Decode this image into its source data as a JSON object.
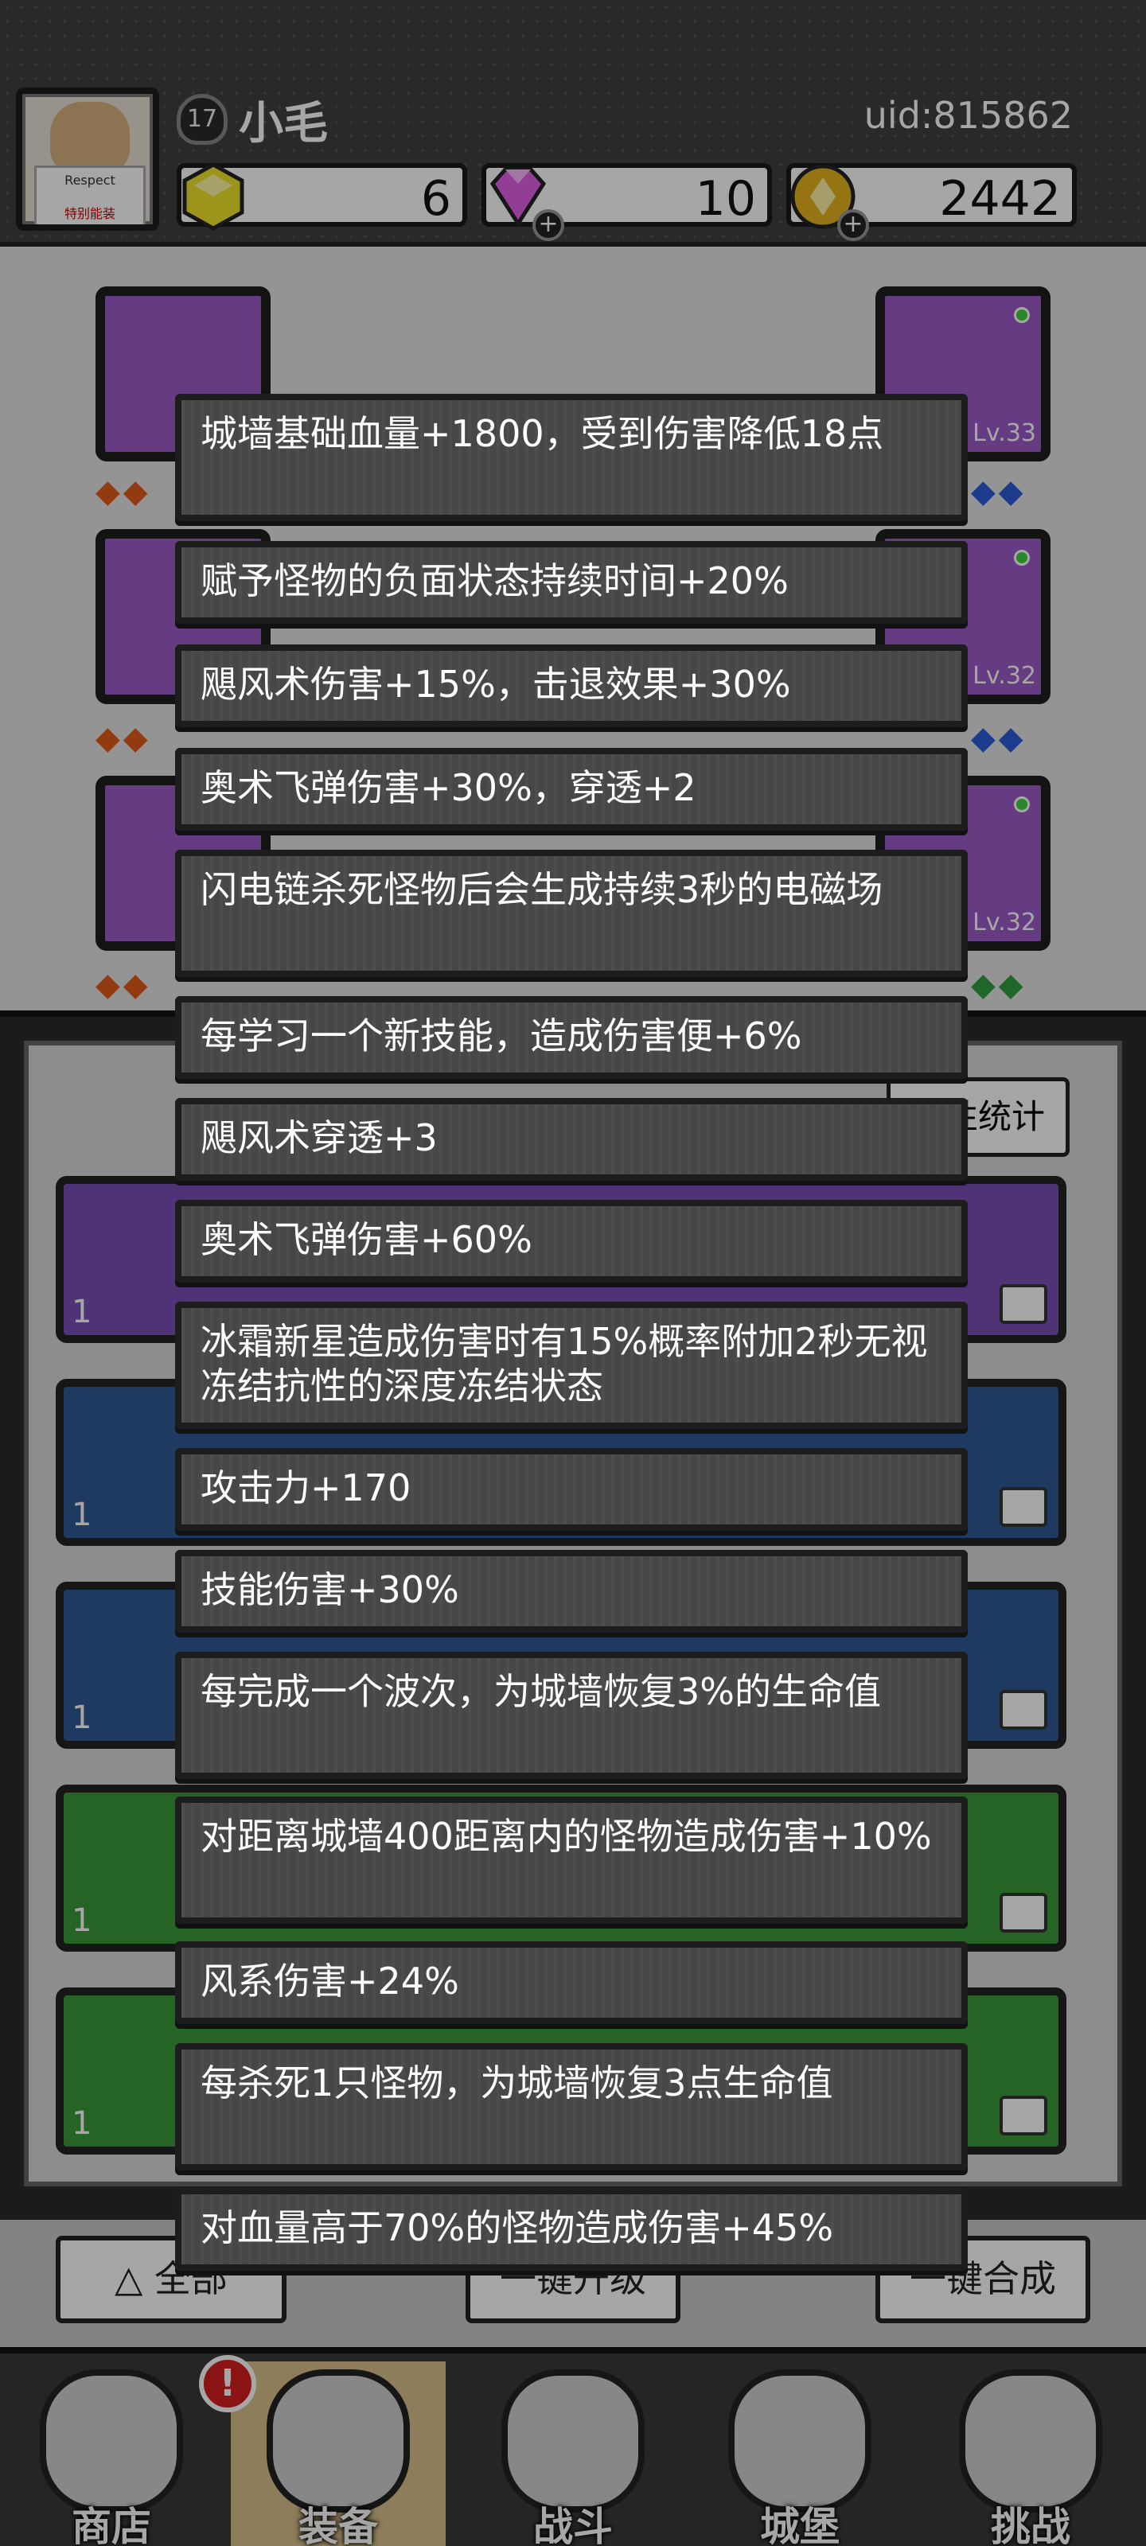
{
  "player": {
    "level": "17",
    "name": "小毛",
    "uid": "uid:815862"
  },
  "avatar": {
    "line1": "Respect",
    "line2": "特别能装"
  },
  "resources": [
    {
      "name": "yellow-gem",
      "value": "6",
      "color": "#f2e32a"
    },
    {
      "name": "pink-diamond",
      "value": "10",
      "color": "#e15fe6"
    },
    {
      "name": "gold-coin",
      "value": "2442",
      "color": "#e3b21e"
    }
  ],
  "equipment_slots": [
    {
      "side": "left",
      "lv": ""
    },
    {
      "side": "left",
      "lv": ""
    },
    {
      "side": "left",
      "lv": ""
    },
    {
      "side": "right",
      "lv": "Lv.33"
    },
    {
      "side": "right",
      "lv": "Lv.32"
    },
    {
      "side": "right",
      "lv": "Lv.32"
    }
  ],
  "panel": {
    "header_right": "属性统计",
    "cards": [
      {
        "color": "#7a4fb7",
        "num": "1"
      },
      {
        "color": "#2f5a96",
        "num": "1"
      },
      {
        "color": "#2f5a96",
        "num": "1"
      },
      {
        "color": "#3b9a3b",
        "num": "1"
      },
      {
        "color": "#3b9a3b",
        "num": "1"
      }
    ]
  },
  "bottom_buttons": {
    "all": "全部",
    "upgrade": "一键升级",
    "merge": "一键合成"
  },
  "tooltips": [
    "城墙基础血量+1800，受到伤害降低18点",
    "赋予怪物的负面状态持续时间+20%",
    "飓风术伤害+15%，击退效果+30%",
    "奥术飞弹伤害+30%，穿透+2",
    "闪电链杀死怪物后会生成持续3秒的电磁场",
    "每学习一个新技能，造成伤害便+6%",
    "飓风术穿透+3",
    "奥术飞弹伤害+60%",
    "冰霜新星造成伤害时有15%概率附加2秒无视冻结抗性的深度冻结状态",
    "攻击力+170",
    "技能伤害+30%",
    "每完成一个波次，为城墙恢复3%的生命值",
    "对距离城墙400距离内的怪物造成伤害+10%",
    "风系伤害+24%",
    "每杀死1只怪物，为城墙恢复3点生命值",
    "对血量高于70%的怪物造成伤害+45%"
  ],
  "nav": {
    "badge": "!",
    "items": [
      {
        "label": "商店"
      },
      {
        "label": "装备"
      },
      {
        "label": "战斗"
      },
      {
        "label": "城堡"
      },
      {
        "label": "挑战"
      }
    ]
  }
}
